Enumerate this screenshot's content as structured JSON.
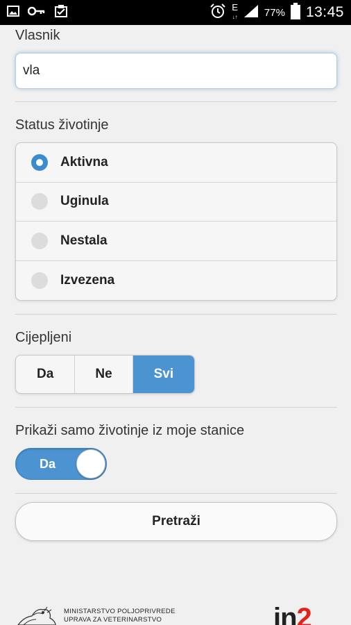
{
  "status_bar": {
    "left_icons": [
      "image-icon",
      "key-icon",
      "clipboard-check-icon"
    ],
    "right_icons": [
      "alarm-icon",
      "data-e-icon",
      "signal-icon",
      "battery-icon"
    ],
    "network_label": "E",
    "battery_percent": "77%",
    "time": "13:45"
  },
  "owner": {
    "label": "Vlasnik",
    "value": "vla"
  },
  "status": {
    "label": "Status životinje",
    "options": [
      {
        "label": "Aktivna",
        "selected": true
      },
      {
        "label": "Uginula",
        "selected": false
      },
      {
        "label": "Nestala",
        "selected": false
      },
      {
        "label": "Izvezena",
        "selected": false
      }
    ]
  },
  "vaccinated": {
    "label": "Cijepljeni",
    "options": [
      {
        "label": "Da",
        "active": false
      },
      {
        "label": "Ne",
        "active": false
      },
      {
        "label": "Svi",
        "active": true
      }
    ]
  },
  "station_filter": {
    "label": "Prikaži samo životinje iz moje stanice",
    "toggle_label": "Da",
    "on": true
  },
  "search_button": {
    "label": "Pretraži"
  },
  "footer": {
    "ministry_line1": "MINISTARSTVO POLJOPRIVREDE",
    "ministry_line2": "UPRAVA ZA VETERINARSTVO",
    "brand_part1": "in",
    "brand_part2": "2",
    "colors": {
      "brand_red": "#e2231a"
    }
  },
  "colors": {
    "accent": "#4b93d1",
    "background": "#f0f0f0"
  }
}
